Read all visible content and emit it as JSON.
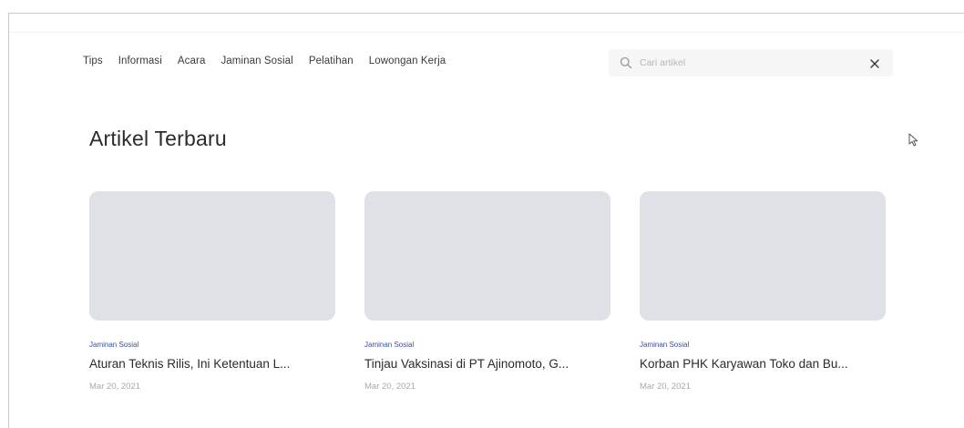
{
  "nav": {
    "items": [
      {
        "label": "Tips"
      },
      {
        "label": "Informasi"
      },
      {
        "label": "Acara"
      },
      {
        "label": "Jaminan Sosial"
      },
      {
        "label": "Pelatihan"
      },
      {
        "label": "Lowongan Kerja"
      }
    ]
  },
  "search": {
    "placeholder": "Cari artikel",
    "value": "",
    "icon": "search-icon",
    "clear_icon": "close-icon"
  },
  "main": {
    "title": "Artikel Terbaru"
  },
  "articles": [
    {
      "category": "Jaminan Sosial",
      "title": "Aturan Teknis Rilis, Ini Ketentuan L...",
      "date": "Mar 20, 2021"
    },
    {
      "category": "Jaminan Sosial",
      "title": "Tinjau Vaksinasi di PT Ajinomoto, G...",
      "date": "Mar 20, 2021"
    },
    {
      "category": "Jaminan Sosial",
      "title": "Korban PHK Karyawan Toko dan Bu...",
      "date": "Mar 20, 2021"
    }
  ],
  "colors": {
    "accent": "#3a4fa0",
    "thumbnail": "#dfe1e6",
    "search_bg": "#f6f6f6"
  }
}
